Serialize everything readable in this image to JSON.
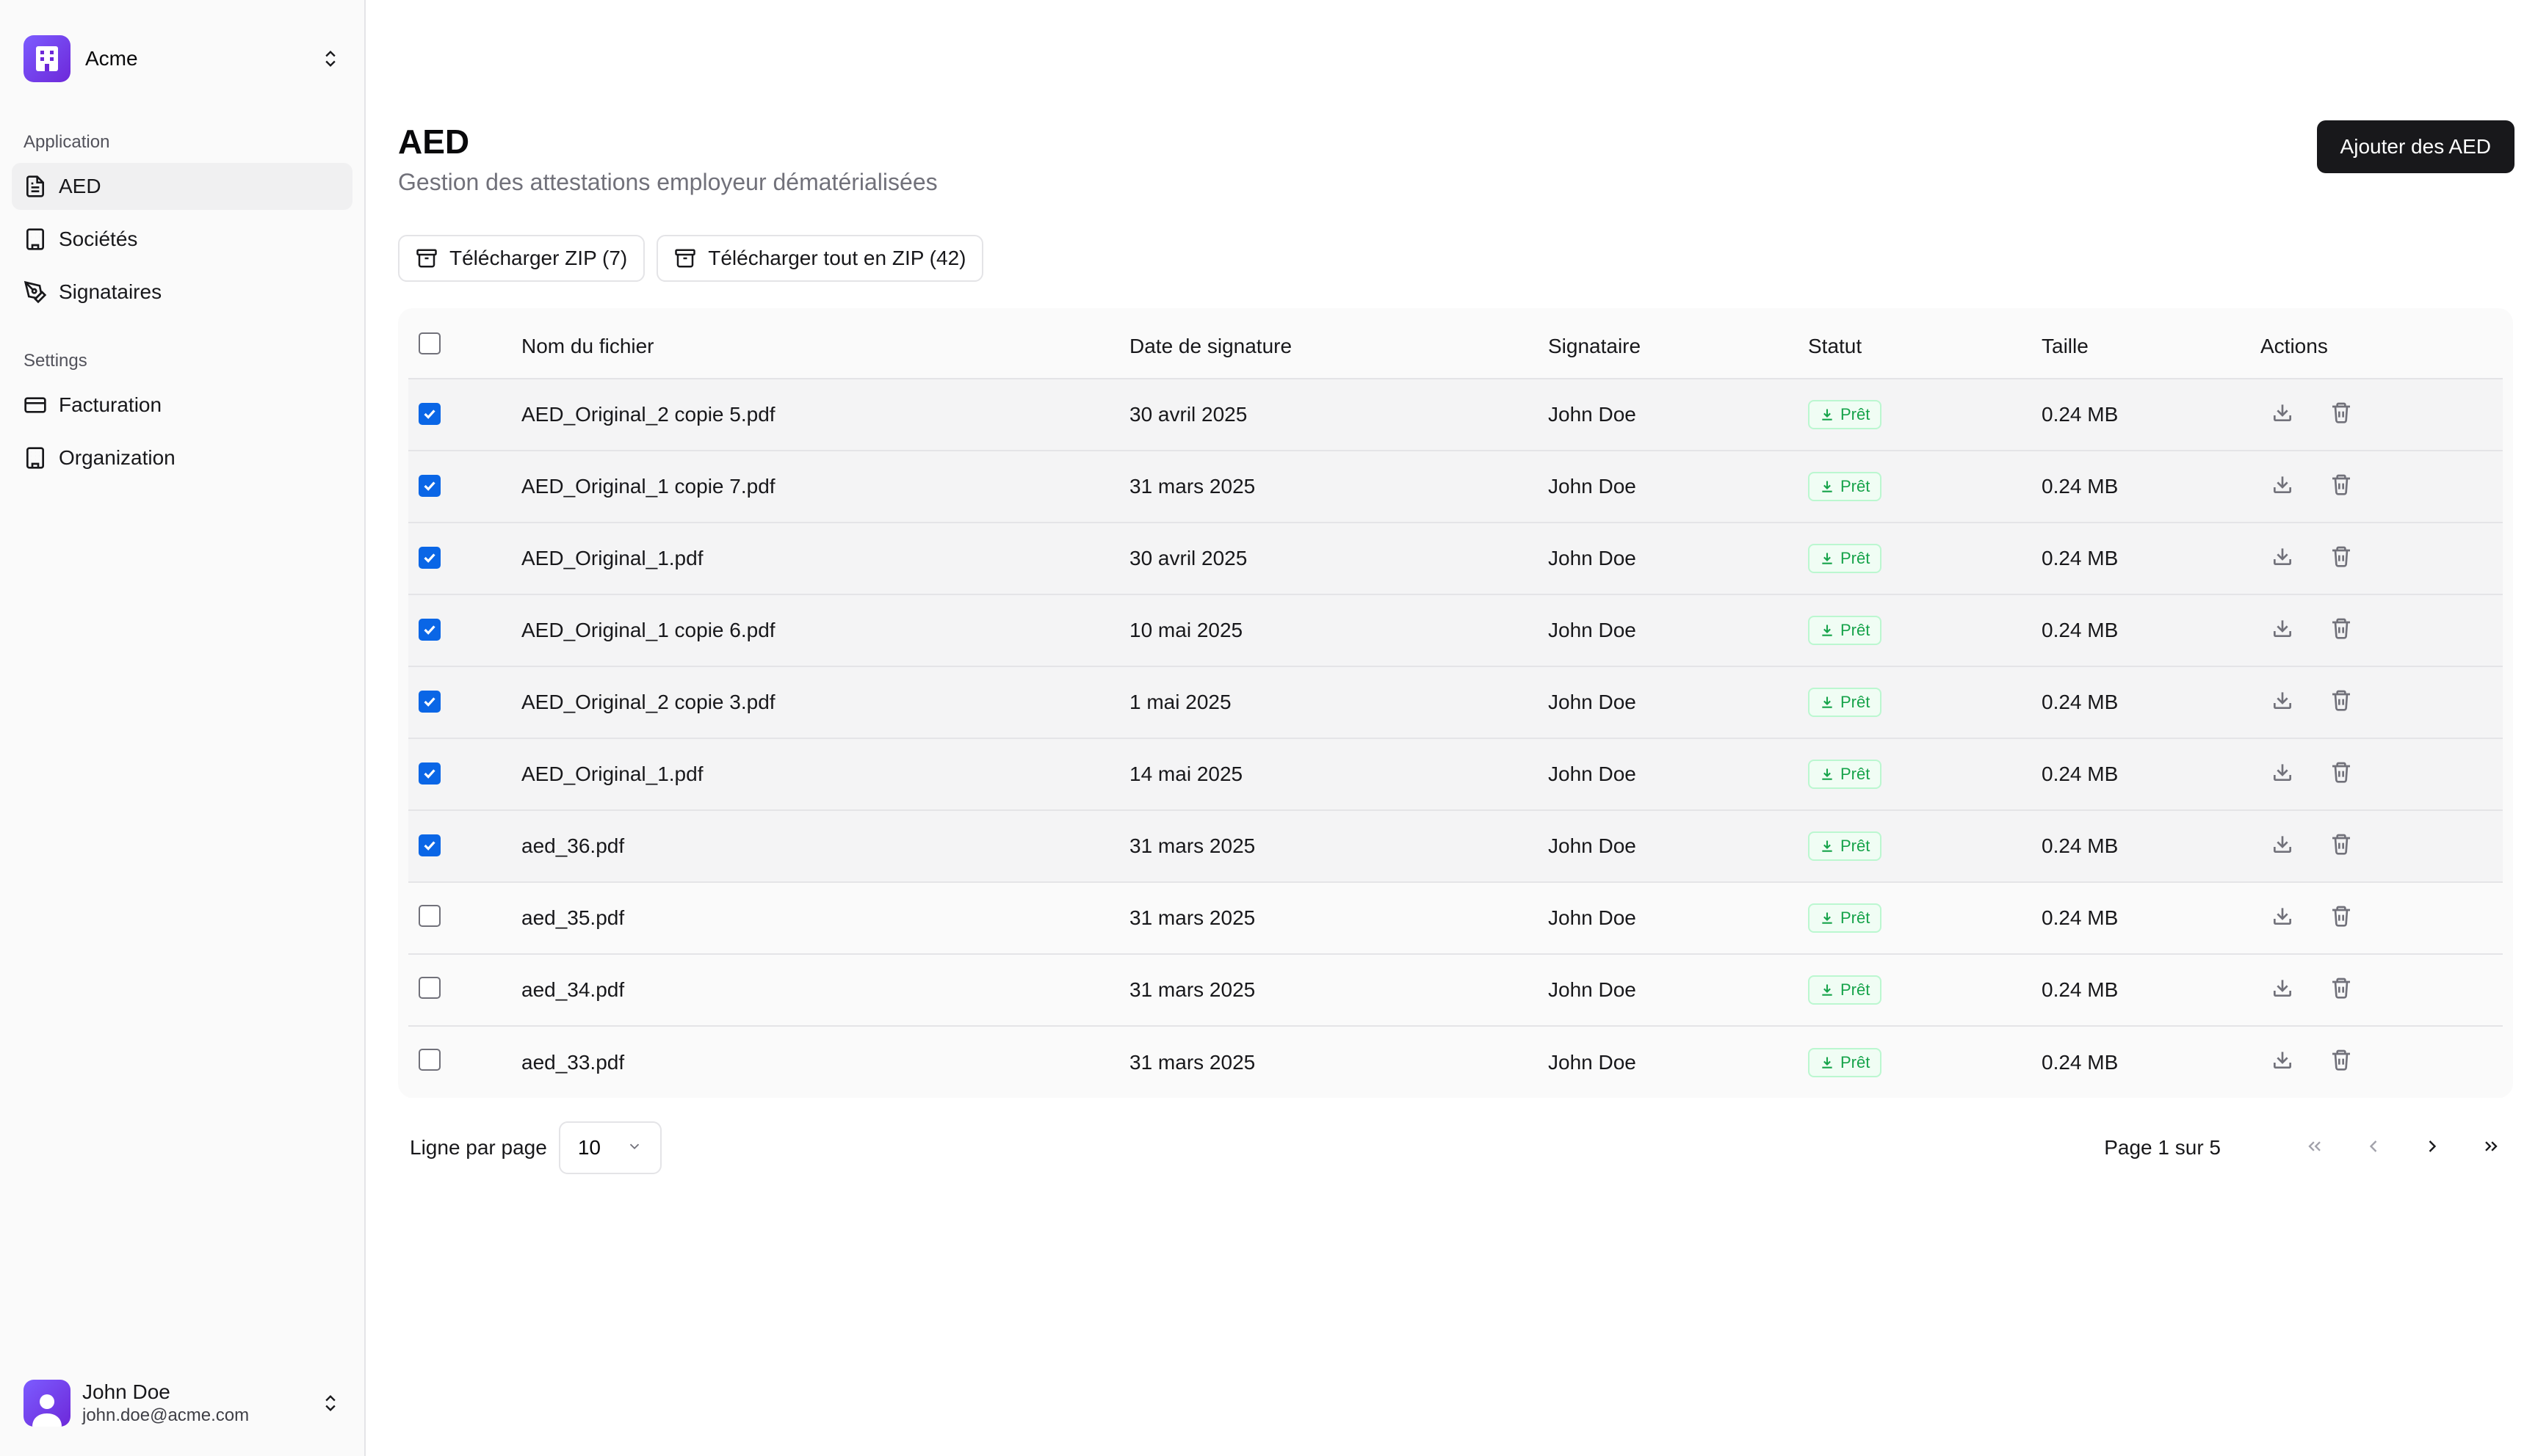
{
  "sidebar": {
    "org_name": "Acme",
    "sections": [
      {
        "label": "Application",
        "items": [
          {
            "label": "AED",
            "icon": "file-text-icon",
            "active": true
          },
          {
            "label": "Sociétés",
            "icon": "building-icon",
            "active": false
          },
          {
            "label": "Signataires",
            "icon": "signature-icon",
            "active": false
          }
        ]
      },
      {
        "label": "Settings",
        "items": [
          {
            "label": "Facturation",
            "icon": "credit-card-icon",
            "active": false
          },
          {
            "label": "Organization",
            "icon": "building-icon",
            "active": false
          }
        ]
      }
    ],
    "user": {
      "name": "John Doe",
      "email": "john.doe@acme.com"
    }
  },
  "header": {
    "title": "AED",
    "subtitle": "Gestion des attestations employeur dématérialisées",
    "primary_button": "Ajouter des AED"
  },
  "toolbar": {
    "download_zip": "Télécharger ZIP (7)",
    "download_all_zip": "Télécharger tout en ZIP (42)"
  },
  "table": {
    "columns": [
      "Nom du fichier",
      "Date de signature",
      "Signataire",
      "Statut",
      "Taille",
      "Actions"
    ],
    "rows": [
      {
        "checked": true,
        "file": "AED_Original_2 copie 5.pdf",
        "date": "30 avril 2025",
        "signer": "John Doe",
        "status": "Prêt",
        "size": "0.24 MB"
      },
      {
        "checked": true,
        "file": "AED_Original_1 copie 7.pdf",
        "date": "31 mars 2025",
        "signer": "John Doe",
        "status": "Prêt",
        "size": "0.24 MB"
      },
      {
        "checked": true,
        "file": "AED_Original_1.pdf",
        "date": "30 avril 2025",
        "signer": "John Doe",
        "status": "Prêt",
        "size": "0.24 MB"
      },
      {
        "checked": true,
        "file": "AED_Original_1 copie 6.pdf",
        "date": "10 mai 2025",
        "signer": "John Doe",
        "status": "Prêt",
        "size": "0.24 MB"
      },
      {
        "checked": true,
        "file": "AED_Original_2 copie 3.pdf",
        "date": "1 mai 2025",
        "signer": "John Doe",
        "status": "Prêt",
        "size": "0.24 MB"
      },
      {
        "checked": true,
        "file": "AED_Original_1.pdf",
        "date": "14 mai 2025",
        "signer": "John Doe",
        "status": "Prêt",
        "size": "0.24 MB"
      },
      {
        "checked": true,
        "file": "aed_36.pdf",
        "date": "31 mars 2025",
        "signer": "John Doe",
        "status": "Prêt",
        "size": "0.24 MB"
      },
      {
        "checked": false,
        "file": "aed_35.pdf",
        "date": "31 mars 2025",
        "signer": "John Doe",
        "status": "Prêt",
        "size": "0.24 MB"
      },
      {
        "checked": false,
        "file": "aed_34.pdf",
        "date": "31 mars 2025",
        "signer": "John Doe",
        "status": "Prêt",
        "size": "0.24 MB"
      },
      {
        "checked": false,
        "file": "aed_33.pdf",
        "date": "31 mars 2025",
        "signer": "John Doe",
        "status": "Prêt",
        "size": "0.24 MB"
      }
    ],
    "action_icons": [
      "download-icon",
      "trash-icon"
    ]
  },
  "pagination": {
    "rows_label": "Ligne par page",
    "rows_value": "10",
    "page_info": "Page 1 sur 5",
    "buttons": [
      "first-page-icon",
      "prev-page-icon",
      "next-page-icon",
      "last-page-icon"
    ]
  },
  "colors": {
    "accent_purple": "#7c5cff",
    "checkbox_blue": "#0a66e6",
    "status_green": "#16a34a",
    "primary_dark": "#18181b"
  }
}
